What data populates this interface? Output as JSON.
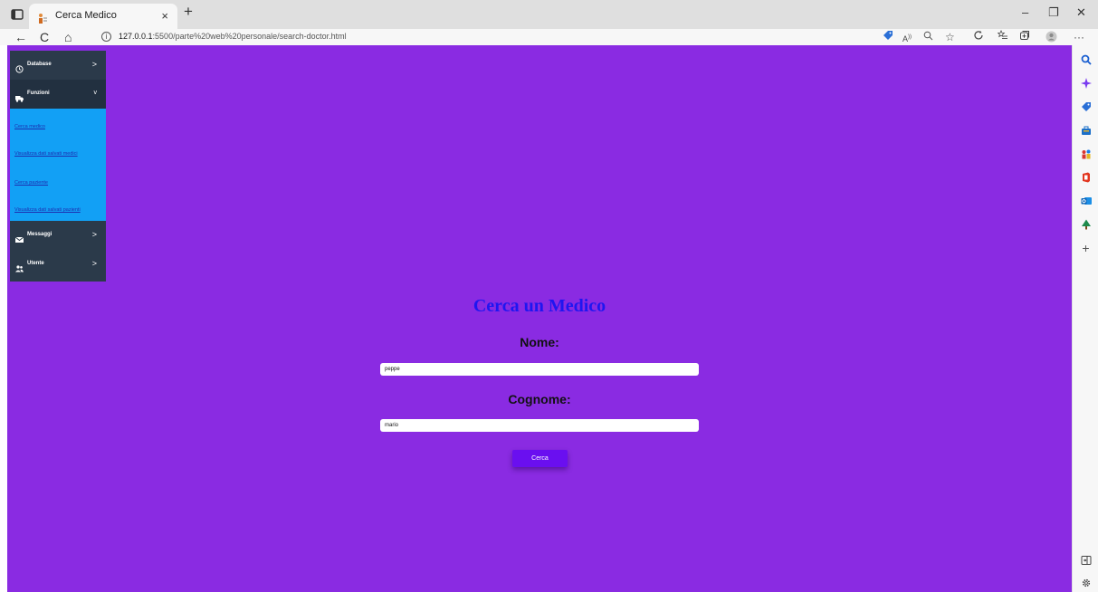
{
  "browser": {
    "tab_title": "Cerca Medico",
    "tab_close": "×",
    "new_tab": "+",
    "url_host": "127.0.0.1",
    "url_rest": ":5500/parte%20web%20personale/search-doctor.html",
    "window_controls": [
      "–",
      "❐",
      "✕"
    ],
    "nav": {
      "back": "←",
      "refresh": "C",
      "home": "⌂"
    },
    "info_icon": "i",
    "toolbar_icons": [
      "tag-icon",
      "read-aloud-icon",
      "zoom-icon",
      "favorite-add-icon",
      "refresh-icon",
      "favorites-icon",
      "collections-icon",
      "profile-icon",
      "more-icon"
    ],
    "more": "···",
    "edge_sidebar_icons": [
      "search-icon",
      "copilot-icon",
      "shopping-icon",
      "tools-icon",
      "games-icon",
      "office-icon",
      "outlook-icon",
      "tree-icon",
      "add-icon",
      "split-screen-icon",
      "settings-icon"
    ]
  },
  "sidebar_menu": {
    "items": [
      {
        "label": "Database",
        "chevron": ">"
      },
      {
        "label": "Funzioni",
        "chevron": "v"
      },
      {
        "label": "Messaggi",
        "chevron": ">"
      },
      {
        "label": "Utente",
        "chevron": ">"
      }
    ],
    "sublinks": [
      "Cerca medico",
      "Visualizza dati salvati medici",
      "Cerca paziente",
      "Visualizza dati salvati pazienti"
    ]
  },
  "form": {
    "title": "Cerca un Medico",
    "name_label": "Nome:",
    "name_value": "peppe",
    "surname_label": "Cognome:",
    "surname_value": "mario",
    "submit_label": "Cerca"
  },
  "colors": {
    "page_bg": "#8a2be2",
    "menu_bg": "#2b3a4a",
    "submenu_bg": "#12a0f5",
    "title_color": "#1f16f0",
    "button_bg": "#6a0ff0"
  }
}
